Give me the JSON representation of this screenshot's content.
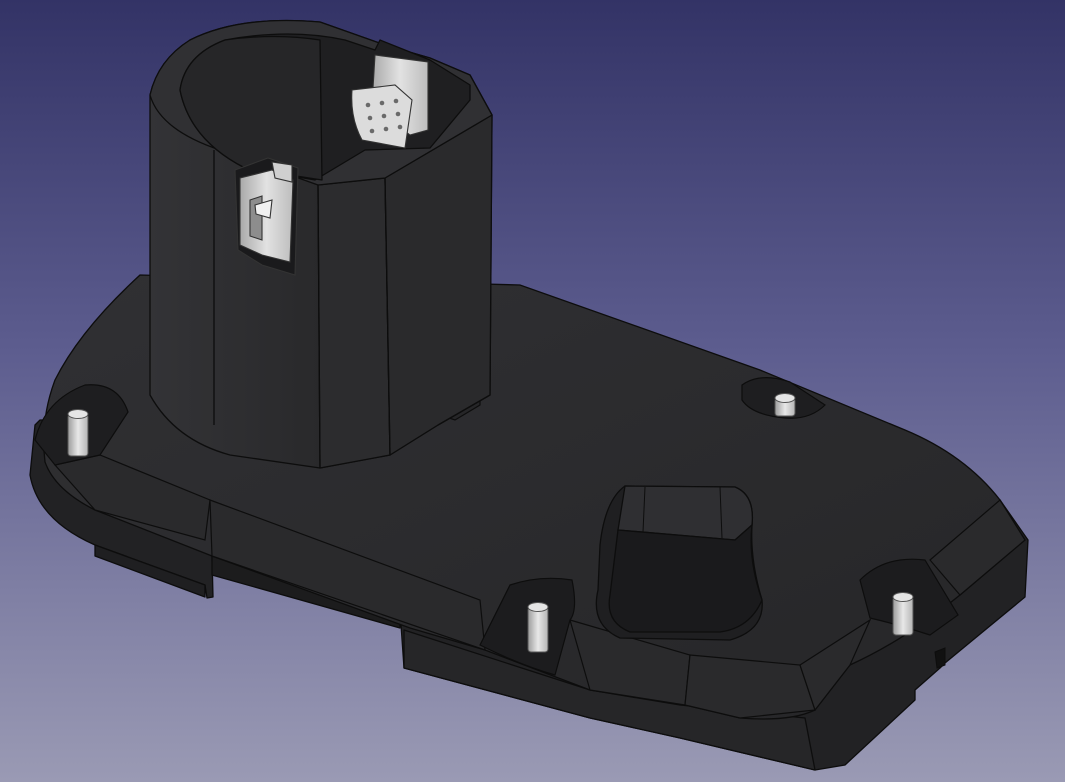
{
  "viewport": {
    "background_top_color": "#333366",
    "background_bottom_color": "#9a9ab4"
  },
  "model": {
    "body_color": "#2b2b2d",
    "edge_color": "#0d0d0d",
    "metal_color": "#c9c9c9",
    "pin_color": "#d4d4d4"
  }
}
